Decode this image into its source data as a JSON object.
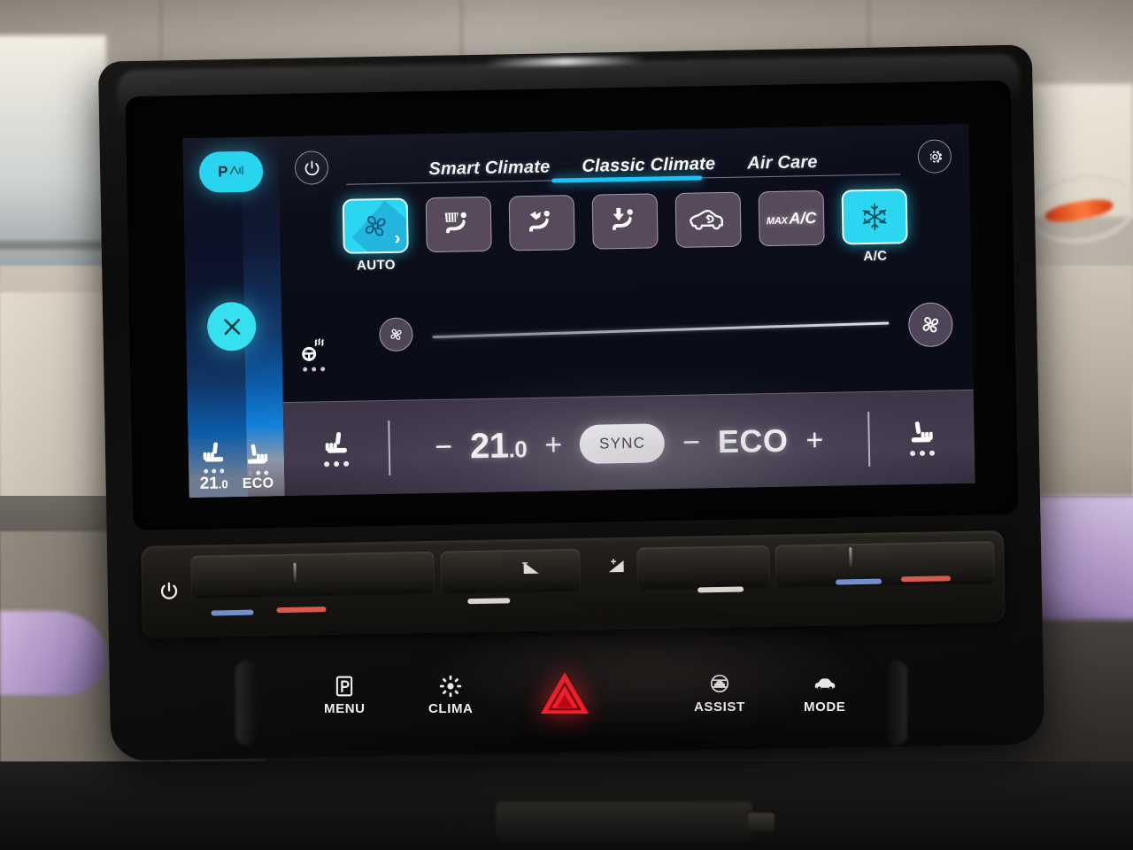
{
  "device": {
    "name": "car-infotainment-head-unit"
  },
  "display": {
    "sidebar": {
      "park_pill": {
        "label": "P",
        "waves": "))",
        "icon": "park-assist-icon"
      },
      "close_button": {
        "icon": "close-x-icon"
      },
      "seats": [
        {
          "icon": "seat-heat-left-icon",
          "value": "21",
          "decimal": ".0"
        },
        {
          "icon": "seat-heat-right-icon",
          "value": "ECO"
        }
      ]
    },
    "topbar": {
      "power_button": {
        "icon": "power-icon"
      },
      "settings_button": {
        "icon": "gear-icon"
      },
      "tabs": [
        {
          "label": "Smart Climate",
          "active": false
        },
        {
          "label": "Classic Climate",
          "active": true
        },
        {
          "label": "Air Care",
          "active": false
        }
      ]
    },
    "modes": [
      {
        "icon": "fan-auto-icon",
        "label": "AUTO",
        "active": true,
        "chevron": "›"
      },
      {
        "icon": "windshield-defrost-seat-icon",
        "label": "",
        "active": false
      },
      {
        "icon": "face-vent-seat-icon",
        "label": "",
        "active": false
      },
      {
        "icon": "foot-vent-seat-icon",
        "label": "",
        "active": false
      },
      {
        "icon": "air-recirculation-icon",
        "label": "",
        "active": false
      },
      {
        "icon": "max-ac-text-icon",
        "label": "",
        "active": false,
        "text_small": "MAX",
        "text_large": "A/C"
      },
      {
        "icon": "snowflake-icon",
        "label": "A/C",
        "active": true
      }
    ],
    "fan_row": {
      "fan_min_icon": "fan-small-icon",
      "fan_max_icon": "fan-large-icon",
      "slider_value": 92
    },
    "steering_heat": {
      "icon": "steering-wheel-heat-icon",
      "dots": 3
    },
    "bottom_bar": {
      "left_seat": {
        "icon": "seat-heat-left-icon",
        "dots": 3
      },
      "temperature": {
        "minus": "−",
        "value": "21",
        "decimal": ".0",
        "plus": "+"
      },
      "sync": {
        "label": "SYNC",
        "active": true
      },
      "eco": {
        "minus": "−",
        "value": "ECO",
        "plus": "+"
      },
      "right_seat": {
        "icon": "seat-heat-right-icon",
        "dots": 3
      }
    }
  },
  "slider_bar": {
    "power_icon": "power-icon",
    "volume_down_label": "−",
    "volume_up_label": "+",
    "left_marks": {
      "cold": "#6f8fd0",
      "warm": "#d85a4a"
    },
    "right_marks": {
      "cold": "#6f8fd0",
      "warm": "#d85a4a"
    }
  },
  "hardware_buttons": [
    {
      "label": "MENU",
      "icon": "park-p-box-icon"
    },
    {
      "label": "CLIMA",
      "icon": "climate-fan-icon"
    },
    {
      "label": "",
      "icon": "hazard-triangle-icon"
    },
    {
      "label": "ASSIST",
      "icon": "assist-car-icon"
    },
    {
      "label": "MODE",
      "icon": "drive-mode-car-icon"
    }
  ],
  "colors": {
    "accent_cyan": "#2ad6f0",
    "tab_active": "#18c3f5",
    "panel_purple": "#574a5c",
    "bottom_bar": "#443b4e",
    "hazard_red": "#ff1f2e"
  }
}
